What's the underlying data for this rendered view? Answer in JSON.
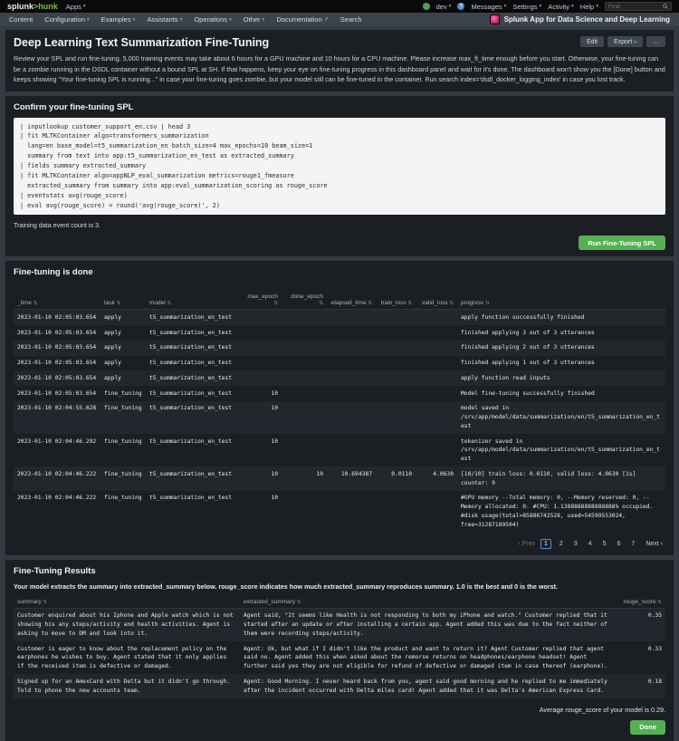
{
  "icons": {
    "caret": "▾",
    "sort": "⇅",
    "external": "↗",
    "more": "…"
  },
  "topnav": {
    "logo_splunk": "splunk",
    "logo_hunk": ">hunk",
    "apps": "Apps",
    "user": "dev",
    "messages_count": "7",
    "messages": "Messages",
    "settings": "Settings",
    "activity": "Activity",
    "help": "Help",
    "find_placeholder": "Find"
  },
  "appbar": {
    "items": [
      {
        "label": "Content"
      },
      {
        "label": "Configuration"
      },
      {
        "label": "Examples"
      },
      {
        "label": "Assistants"
      },
      {
        "label": "Operations"
      },
      {
        "label": "Other"
      },
      {
        "label": "Documentation"
      },
      {
        "label": "Search"
      }
    ],
    "app_name": "Splunk App for Data Science and Deep Learning"
  },
  "header": {
    "title": "Deep Learning Text Summarization Fine-Tuning",
    "edit_button": "Edit",
    "export_button": "Export",
    "description": "Review your SPL and run fine-tuning. 5,000 training events may take about 6 hours for a GPU machine and 10 hours for a CPU machine. Please increase max_ft_time enough before you start. Otherwise, your fine-tuning can be a zombie running in the DSDL container without a bound SPL at SH. If that happens, keep your eye on fine-tuning progress in this dashboard panel and wait for it's done. The dashboard won't show you the [Done] button and keeps showing \"Your fine-tuning SPL is running...\" in case your fine-tuning goes zombie, but your model still can be fine-tuned in the container. Run search index='dsdl_docker_logging_index' in case you lost track."
  },
  "panel_spl": {
    "title": "Confirm your fine-tuning SPL",
    "code": "| inputlookup customer_support_en.csv | head 3\n| fit MLTKContainer algo=transformers_summarization\n  lang=en base_model=t5_summarization_en batch_size=4 max_epochs=10 beam_size=1\n  summary from text into app:t5_summarization_en_test as extracted_summary\n| fields summary extracted_summary\n| fit MLTKContainer algo=appNLP_eval_summarization metrics=rouge1_fmeasure\n  extracted_summary from summary into app:eval_summarization_scoring as rouge_score\n| eventstats avg(rouge_score)\n| eval avg(rouge_score) = round('avg(rouge_score)', 2)",
    "note": "Training data event count is 3.",
    "run_button": "Run Fine-Tuning SPL"
  },
  "panel_progress": {
    "title": "Fine-tuning is done",
    "columns": [
      "_time",
      "task",
      "model",
      "max_epoch",
      "done_epoch",
      "elapsed_time",
      "train_loss",
      "valid_loss",
      "progress"
    ],
    "rows": [
      [
        "2023-01-10 02:05:03.654",
        "apply",
        "t5_summarization_en_test",
        "",
        "",
        "",
        "",
        "",
        "apply function successfully finished"
      ],
      [
        "2023-01-10 02:05:03.654",
        "apply",
        "t5_summarization_en_test",
        "",
        "",
        "",
        "",
        "",
        "finished applying 3 out of 3 utterances"
      ],
      [
        "2023-01-10 02:05:03.654",
        "apply",
        "t5_summarization_en_test",
        "",
        "",
        "",
        "",
        "",
        "finished applying 2 out of 3 utterances"
      ],
      [
        "2023-01-10 02:05:03.654",
        "apply",
        "t5_summarization_en_test",
        "",
        "",
        "",
        "",
        "",
        "finished applying 1 out of 3 utterances"
      ],
      [
        "2023-01-10 02:05:03.654",
        "apply",
        "t5_summarization_en_test",
        "",
        "",
        "",
        "",
        "",
        "apply function read inputs"
      ],
      [
        "2023-01-10 02:05:03.654",
        "fine_tuning",
        "t5_summarization_en_test",
        "10",
        "",
        "",
        "",
        "",
        "Model fine-tuning successfully finished"
      ],
      [
        "2023-01-10 02:04:55.628",
        "fine_tuning",
        "t5_summarization_en_test",
        "10",
        "",
        "",
        "",
        "",
        "model saved in /srv/app/model/data/summarization/en/t5_summarization_en_test"
      ],
      [
        "2023-01-10 02:04:46.292",
        "fine_tuning",
        "t5_summarization_en_test",
        "10",
        "",
        "",
        "",
        "",
        "tokenizer saved in /srv/app/model/data/summarization/en/t5_summarization_en_test"
      ],
      [
        "2023-01-10 02:04:46.222",
        "fine_tuning",
        "t5_summarization_en_test",
        "10",
        "10",
        "10.694387",
        "0.0110",
        "4.0630",
        "[10/10] train loss: 0.0110, valid loss: 4.0630 [1s] counter: 9"
      ],
      [
        "2023-01-10 02:04:46.222",
        "fine_tuning",
        "t5_summarization_en_test",
        "10",
        "",
        "",
        "",
        "",
        "#GPU memory --Total memory: 0, --Memory reserved: 0, --Memory allocated: 0. #CPU: 1.1388888888888888% occupied. #disk usage(total=85886742528, used=54599553024, free=31287189504)"
      ]
    ],
    "pagination": {
      "prev": "‹ Prev",
      "pages": [
        "1",
        "2",
        "3",
        "4",
        "5",
        "6",
        "7"
      ],
      "next": "Next ›"
    }
  },
  "panel_results": {
    "title": "Fine-Tuning Results",
    "description": "Your model extracts the summary into extracted_summary below. rouge_score indicates how much extracted_summary reproduces summary. 1.0 is the best and 0 is the worst.",
    "columns": [
      "summary",
      "extracted_summary",
      "rouge_score"
    ],
    "rows": [
      {
        "summary": "Customer enquired about his Iphone and Apple watch which is not showing his any steps/activity and health activities. Agent is asking to move to DM and look into it.",
        "extracted": "Agent said, \"It seems like Health is not responding to both my iPhone and watch.\" Customer replied that it started after an update or after installing a certain app. Agent added this was due to the fact neither of them were recording steps/activity.",
        "score": "0.35"
      },
      {
        "summary": "Customer is eager to know about the replacement policy on the earphones he wishes to buy. Agent stated that it only applies if the received item is defective or damaged.",
        "extracted": "Agent: Ok, but what if I didn't like the product and want to return it? Agent Customer replied that agent said no. Agent added this when asked about the remorse returns on headphones/earphone headset! Agent further said yes they are not eligible for refund of defective or damaged item in case thereof (earphone).",
        "score": "0.33"
      },
      {
        "summary": "Signed up for an AmexCard with Delta but it didn't go through. Told to phone the new accounts team.",
        "extracted": "Agent: Good Morning. I never heard back from you, agent said good morning and he replied to me immediately after the incident occurred with Delta miles card! Agent added that it was Delta's American Express Card.",
        "score": "0.18"
      }
    ],
    "average_note": "Average rouge_score of your model is 0.29.",
    "done_button": "Done"
  }
}
